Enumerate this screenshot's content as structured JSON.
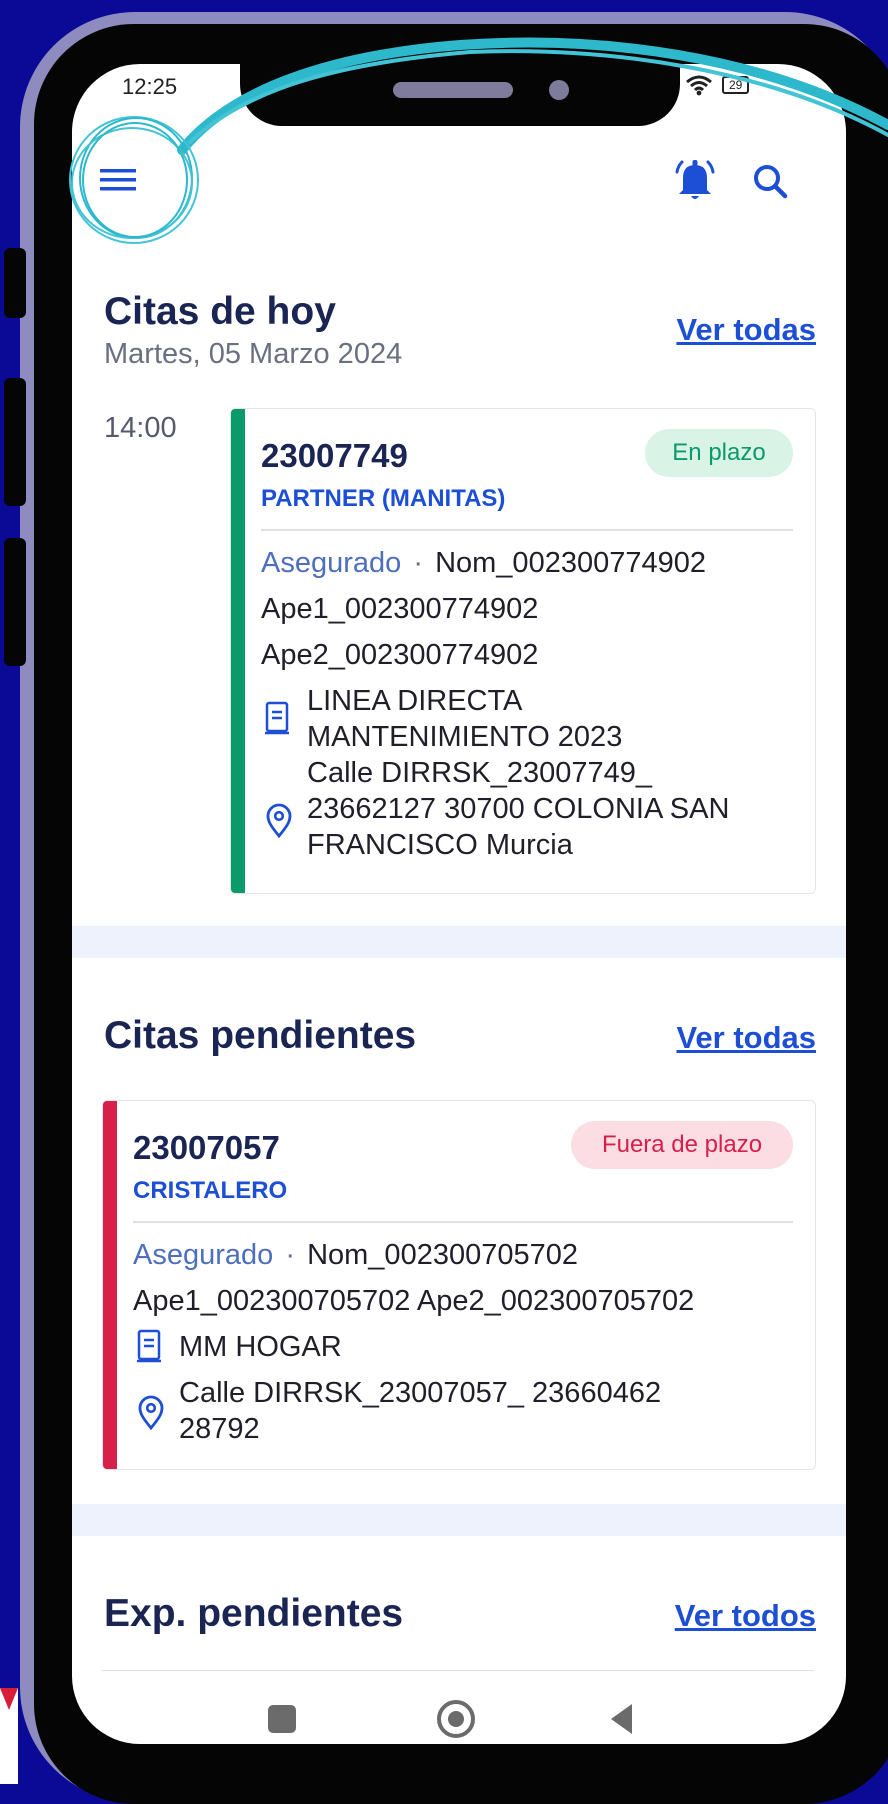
{
  "status_bar": {
    "time": "12:25",
    "battery": "29"
  },
  "top_bar": {
    "menu_icon": "hamburger-menu-icon",
    "bell_icon": "bell-icon",
    "search_icon": "search-icon"
  },
  "today": {
    "title": "Citas de hoy",
    "date": "Martes, 05 Marzo 2024",
    "see_all": "Ver todas",
    "appointment": {
      "time": "14:00",
      "number": "23007749",
      "trade": "PARTNER (MANITAS)",
      "status": "En plazo",
      "insured_label": "Asegurado",
      "separator": "·",
      "name": "Nom_002300774902",
      "ape1": "Ape1_002300774902",
      "ape2": "Ape2_002300774902",
      "policy_line1": "LINEA DIRECTA",
      "policy_line2": "MANTENIMIENTO 2023",
      "address_line1": "Calle DIRRSK_23007749_",
      "address_line2": "23662127 30700 COLONIA SAN",
      "address_line3": "FRANCISCO Murcia"
    }
  },
  "pending": {
    "title": "Citas pendientes",
    "see_all": "Ver todas",
    "appointment": {
      "number": "23007057",
      "trade": "CRISTALERO",
      "status": "Fuera de plazo",
      "insured_label": "Asegurado",
      "separator": "·",
      "name": "Nom_002300705702",
      "surnames": "Ape1_002300705702 Ape2_002300705702",
      "policy": "MM HOGAR",
      "address_line1": "Calle DIRRSK_23007057_ 23660462",
      "address_line2": "28792"
    }
  },
  "files": {
    "title": "Exp. pendientes",
    "see_all": "Ver todos"
  },
  "colors": {
    "green": "#0b9a6a",
    "red": "#d81f4a",
    "blue": "#1d4fd6",
    "navy": "#1b2553",
    "background": "#0a0a96"
  }
}
